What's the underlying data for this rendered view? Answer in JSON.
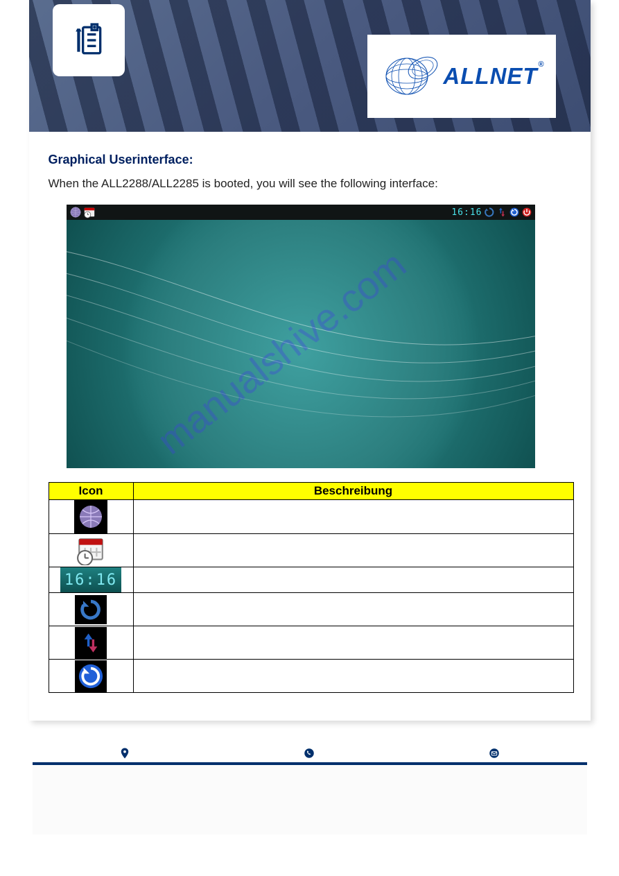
{
  "logo": {
    "brand": "ALLNET",
    "reg": "®"
  },
  "section": {
    "title": "Graphical Userinterface:",
    "intro": "When the ALL2288/ALL2285 is booted, you will see the following interface:"
  },
  "screenshot": {
    "clock": "16:16",
    "watermark": "manualshive.com"
  },
  "table": {
    "headers": {
      "icon": "Icon",
      "desc": "Beschreibung"
    },
    "rows": [
      {
        "icon_name": "network-globe-icon",
        "desc": ""
      },
      {
        "icon_name": "calendar-clock-icon",
        "desc": ""
      },
      {
        "icon_name": "digital-clock-icon",
        "desc": ""
      },
      {
        "icon_name": "refresh-arrow-icon",
        "desc": ""
      },
      {
        "icon_name": "up-down-arrows-icon",
        "desc": ""
      },
      {
        "icon_name": "restart-circle-icon",
        "desc": ""
      }
    ]
  }
}
